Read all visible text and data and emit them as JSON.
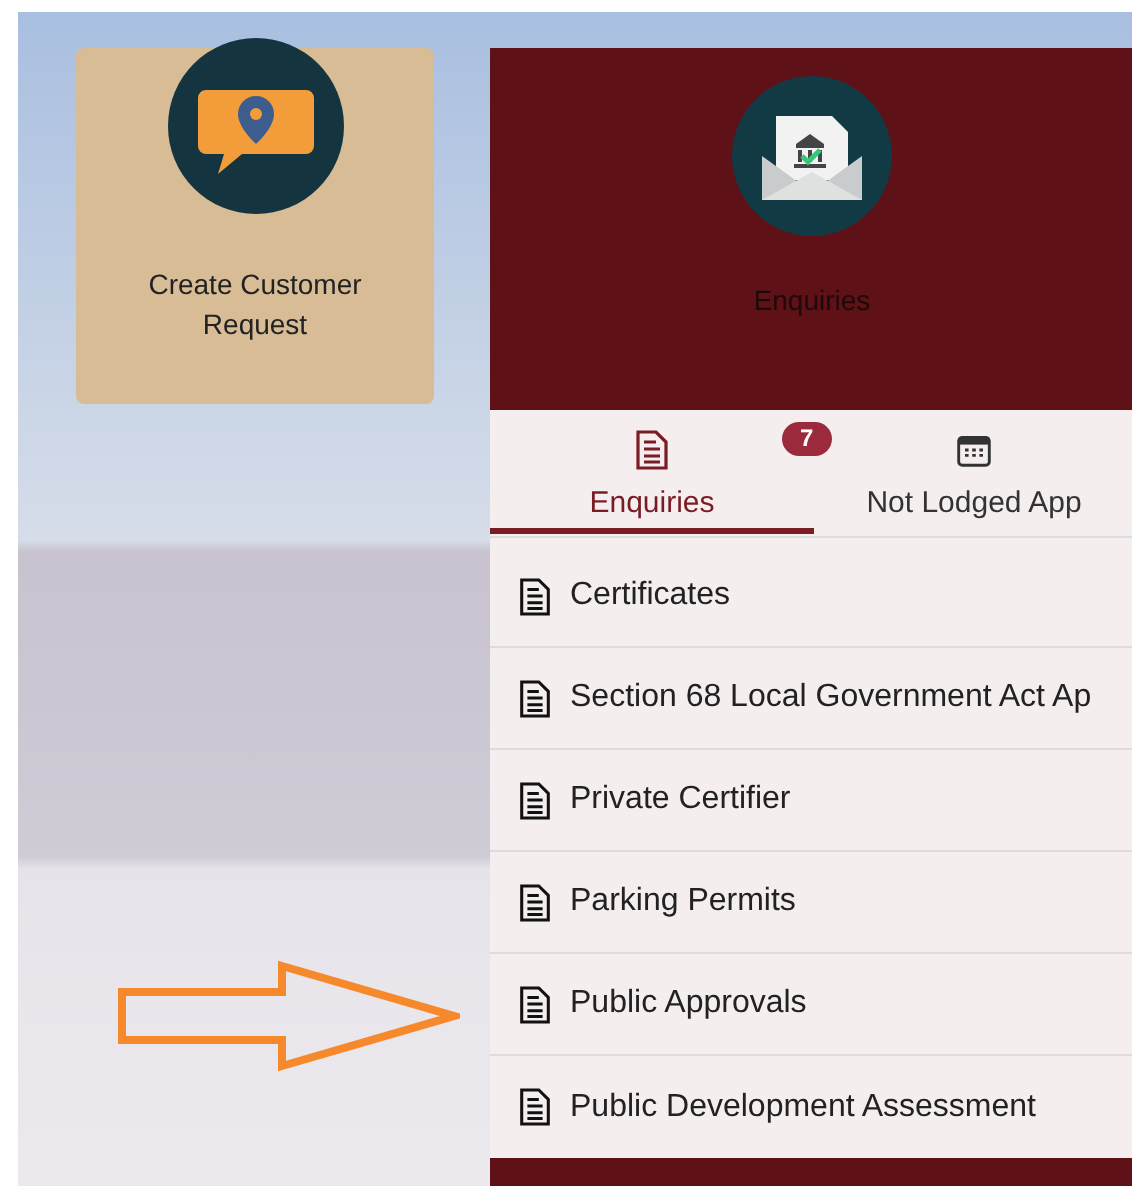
{
  "tile": {
    "label": "Create Customer Request"
  },
  "panel": {
    "title": "Enquiries",
    "tabs": [
      {
        "kind": "document",
        "label": "Enquiries",
        "selected": true,
        "badge": "7"
      },
      {
        "kind": "calendar",
        "label": "Not Lodged App",
        "selected": false
      }
    ],
    "items": [
      {
        "label": "Certificates"
      },
      {
        "label": "Section 68 Local Government Act Ap"
      },
      {
        "label": "Private Certifier"
      },
      {
        "label": "Parking Permits"
      },
      {
        "label": "Public Approvals"
      },
      {
        "label": "Public Development Assessment"
      }
    ]
  }
}
